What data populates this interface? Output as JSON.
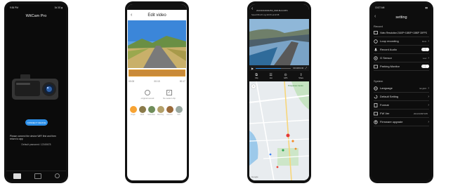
{
  "p1": {
    "status_time": "9:36 PM",
    "status_right": "3d 3G ▮",
    "app_title": "WitCam Pro",
    "connect_btn": "CONNECT DEVICE",
    "help_text": "Please connect the device WiFi first and then return to app",
    "default_password": "Default password: 12345678"
  },
  "p2": {
    "title": "Edit video",
    "times": [
      "00:00",
      "00:15",
      "00:17"
    ],
    "options": [
      "original sound",
      "No select clip"
    ],
    "filters": [
      "Origin",
      "Dark",
      "Suburban",
      "Morning",
      "Autumn",
      "Soft"
    ]
  },
  "p3": {
    "file_name": "20231016094250_0021Mob.MP4",
    "speed_text": "Speed:0Km/h Lng:113.8 Lat:22.68",
    "duration": "00:43/01:00",
    "tools": [
      "Clip",
      "List",
      "GPS",
      "Share"
    ],
    "map_labels": [
      "Prosperous Centre"
    ],
    "map_logo": "Google"
  },
  "p4": {
    "status_time": "10:37 AM",
    "title": "setting",
    "section_record": "Record",
    "record_rows": [
      {
        "label": "Video Resolution:2160P+1080P+1080P 30FPS",
        "value": ""
      },
      {
        "label": "Loop recording",
        "value": "3min"
      },
      {
        "label": "Record Audio",
        "value": ""
      },
      {
        "label": "G Sensor",
        "value": "Low"
      },
      {
        "label": "Parking Monitor",
        "value": ""
      }
    ],
    "section_system": "System",
    "system_rows": [
      {
        "label": "Language",
        "value": "English"
      },
      {
        "label": "Default Setting",
        "value": ""
      },
      {
        "label": "Format",
        "value": ""
      },
      {
        "label": "FW Ver",
        "value": "20221009T185"
      },
      {
        "label": "Firmware upgrade",
        "value": ""
      }
    ]
  }
}
